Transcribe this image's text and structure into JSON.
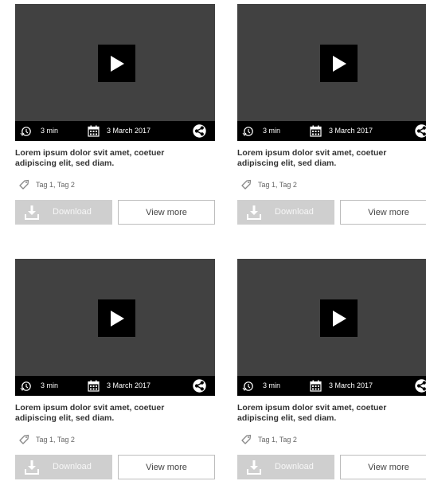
{
  "cards": [
    {
      "duration": "3 min",
      "date": "3 March 2017",
      "description": "Lorem ipsum dolor svit amet, coetuer adipiscing elit, sed diam.",
      "tags": "Tag 1, Tag 2",
      "download_label": "Download",
      "view_more_label": "View more"
    },
    {
      "duration": "3 min",
      "date": "3 March 2017",
      "description": "Lorem ipsum dolor svit amet, coetuer adipiscing elit, sed diam.",
      "tags": "Tag 1, Tag 2",
      "download_label": "Download",
      "view_more_label": "View more"
    },
    {
      "duration": "3 min",
      "date": "3 March 2017",
      "description": "Lorem ipsum dolor svit amet, coetuer adipiscing elit, sed diam.",
      "tags": "Tag 1, Tag 2",
      "download_label": "Download",
      "view_more_label": "View more"
    },
    {
      "duration": "3 min",
      "date": "3 March 2017",
      "description": "Lorem ipsum dolor svit amet, coetuer adipiscing elit, sed diam.",
      "tags": "Tag 1, Tag 2",
      "download_label": "Download",
      "view_more_label": "View more"
    }
  ],
  "icons": {
    "play": "play-icon",
    "duration": "clock-icon",
    "date": "calendar-icon",
    "share": "share-icon",
    "tags": "tag-icon",
    "download": "download-icon"
  },
  "colors": {
    "video_bg": "#414141",
    "meta_bar": "#000000",
    "download_bg": "#cfcfcf",
    "view_more_border": "#bdbdbd"
  }
}
